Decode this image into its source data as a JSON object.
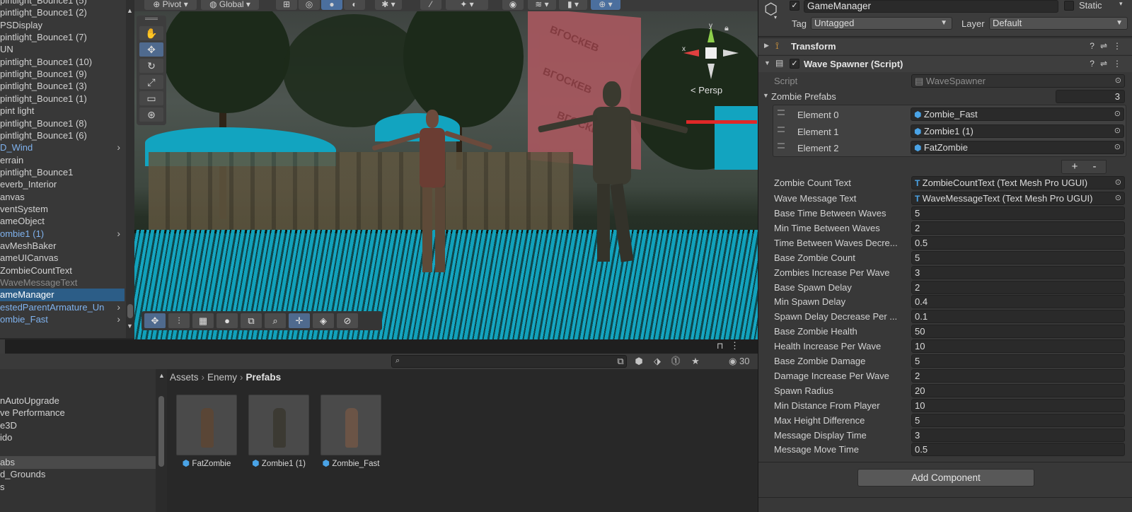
{
  "hierarchy": {
    "items": [
      {
        "label": "pintlight_Bounce1 (5)",
        "type": "normal"
      },
      {
        "label": "pintlight_Bounce1 (2)",
        "type": "normal"
      },
      {
        "label": "PSDisplay",
        "type": "normal"
      },
      {
        "label": "pintlight_Bounce1 (7)",
        "type": "normal"
      },
      {
        "label": "UN",
        "type": "normal"
      },
      {
        "label": "pintlight_Bounce1 (10)",
        "type": "normal"
      },
      {
        "label": "pintlight_Bounce1 (9)",
        "type": "normal"
      },
      {
        "label": "pintlight_Bounce1 (3)",
        "type": "normal"
      },
      {
        "label": "pintlight_Bounce1 (1)",
        "type": "normal"
      },
      {
        "label": "pint light",
        "type": "normal"
      },
      {
        "label": "pintlight_Bounce1 (8)",
        "type": "normal"
      },
      {
        "label": "pintlight_Bounce1 (6)",
        "type": "normal"
      },
      {
        "label": "D_Wind",
        "type": "prefab",
        "expand": "›"
      },
      {
        "label": "errain",
        "type": "normal"
      },
      {
        "label": "pintlight_Bounce1",
        "type": "normal"
      },
      {
        "label": "everb_Interior",
        "type": "normal"
      },
      {
        "label": "anvas",
        "type": "normal"
      },
      {
        "label": "ventSystem",
        "type": "normal"
      },
      {
        "label": "ameObject",
        "type": "normal"
      },
      {
        "label": "ombie1 (1)",
        "type": "prefab",
        "expand": "›"
      },
      {
        "label": "avMeshBaker",
        "type": "normal"
      },
      {
        "label": "ameUICanvas",
        "type": "normal"
      },
      {
        "label": " ZombieCountText",
        "type": "normal"
      },
      {
        "label": " WaveMessageText",
        "type": "dim"
      },
      {
        "label": "ameManager",
        "type": "selected"
      },
      {
        "label": "estedParentArmature_Un",
        "type": "prefab",
        "expand": "›"
      },
      {
        "label": "ombie_Fast",
        "type": "prefab",
        "expand": "›"
      }
    ]
  },
  "scene_toolbar": {
    "pivot": "Pivot",
    "global": "Global"
  },
  "scene": {
    "gizmo_view": "< Persp",
    "gizmo_x": "x",
    "gizmo_y": "y",
    "building_watermark": "BГОСКЕВ"
  },
  "project": {
    "breadcrumb": [
      "Assets",
      "Enemy",
      "Prefabs"
    ],
    "search": {
      "value": "",
      "placeholder": ""
    },
    "hidden_count": "30",
    "folders": [
      {
        "label": "nAutoUpgrade",
        "selected": false
      },
      {
        "label": "ve Performance",
        "selected": false
      },
      {
        "label": "e3D",
        "selected": false
      },
      {
        "label": "ido",
        "selected": false
      },
      {
        "label": "",
        "selected": false
      },
      {
        "label": "abs",
        "selected": true
      },
      {
        "label": "d_Grounds",
        "selected": false
      },
      {
        "label": "s",
        "selected": false
      }
    ],
    "assets": [
      {
        "label": "FatZombie",
        "color": "#5a4636"
      },
      {
        "label": "Zombie1 (1)",
        "color": "#3c3a33"
      },
      {
        "label": "Zombie_Fast",
        "color": "#6b5446"
      }
    ]
  },
  "inspector": {
    "object_name": "GameManager",
    "static_label": "Static",
    "tag_label": "Tag",
    "tag_value": "Untagged",
    "layer_label": "Layer",
    "layer_value": "Default",
    "transform_title": "Transform",
    "wave_title": "Wave Spawner (Script)",
    "script_label": "Script",
    "script_value": "WaveSpawner",
    "zombie_prefabs_label": "Zombie Prefabs",
    "zombie_prefabs_count": "3",
    "elements": [
      {
        "label": "Element 0",
        "value": "Zombie_Fast"
      },
      {
        "label": "Element 1",
        "value": "Zombie1 (1)"
      },
      {
        "label": "Element 2",
        "value": "FatZombie"
      }
    ],
    "plus": "+",
    "minus": "-",
    "refs": [
      {
        "label": "Zombie Count Text",
        "value": "ZombieCountText (Text Mesh Pro UGUI)"
      },
      {
        "label": "Wave Message Text",
        "value": "WaveMessageText (Text Mesh Pro UGUI)"
      }
    ],
    "fields": [
      {
        "label": "Base Time Between Waves",
        "value": "5"
      },
      {
        "label": "Min Time Between Waves",
        "value": "2"
      },
      {
        "label": "Time Between Waves Decre...",
        "value": "0.5"
      },
      {
        "label": "Base Zombie Count",
        "value": "5"
      },
      {
        "label": "Zombies Increase Per Wave",
        "value": "3"
      },
      {
        "label": "Base Spawn Delay",
        "value": "2"
      },
      {
        "label": "Min Spawn Delay",
        "value": "0.4"
      },
      {
        "label": "Spawn Delay Decrease Per ...",
        "value": "0.1"
      },
      {
        "label": "Base Zombie Health",
        "value": "50"
      },
      {
        "label": "Health Increase Per Wave",
        "value": "10"
      },
      {
        "label": "Base Zombie Damage",
        "value": "5"
      },
      {
        "label": "Damage Increase Per Wave",
        "value": "2"
      },
      {
        "label": "Spawn Radius",
        "value": "20"
      },
      {
        "label": "Min Distance From Player",
        "value": "10"
      },
      {
        "label": "Max Height Difference",
        "value": "5"
      },
      {
        "label": "Message Display Time",
        "value": "3"
      },
      {
        "label": "Message Move Time",
        "value": "0.5"
      }
    ],
    "add_component": "Add Component"
  },
  "colors": {
    "selection": "#2c5d87",
    "prefab_text": "#7fb2ee",
    "water": "#12a4c0",
    "building": "#a9585f",
    "active_tool": "#4f6a8e"
  }
}
